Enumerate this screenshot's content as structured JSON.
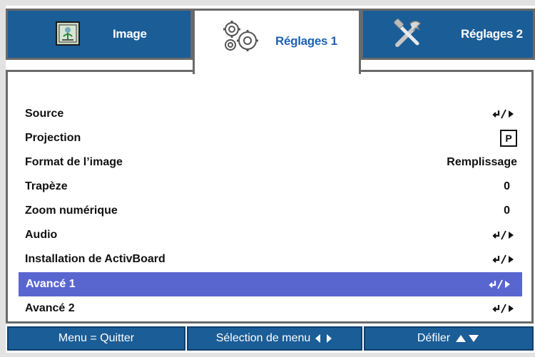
{
  "tabs": [
    {
      "label": "Image",
      "icon": "image-icon",
      "active": false
    },
    {
      "label": "Réglages 1",
      "icon": "gears-icon",
      "active": true
    },
    {
      "label": "Réglages 2",
      "icon": "tools-icon",
      "active": false
    }
  ],
  "menu": {
    "rows": [
      {
        "label": "Source",
        "value_icon": "enter-right-icon"
      },
      {
        "label": "Projection",
        "value": "P"
      },
      {
        "label": "Format de l’image",
        "value": "Remplissage"
      },
      {
        "label": "Trapèze",
        "value": "0"
      },
      {
        "label": "Zoom numérique",
        "value": "0"
      },
      {
        "label": "Audio",
        "value_icon": "enter-right-icon"
      },
      {
        "label": "Installation de ActivBoard",
        "value_icon": "enter-right-icon"
      },
      {
        "label": "Avancé 1",
        "value_icon": "enter-right-icon",
        "selected": true
      },
      {
        "label": "Avancé 2",
        "value_icon": "enter-right-icon"
      }
    ]
  },
  "footer": {
    "quit": "Menu = Quitter",
    "select": "Sélection de menu",
    "scroll": "Défiler"
  },
  "colors": {
    "tab_bg": "#1b5d97",
    "active_tab_text": "#1f62b3",
    "selection_bg": "#5a66d0"
  }
}
